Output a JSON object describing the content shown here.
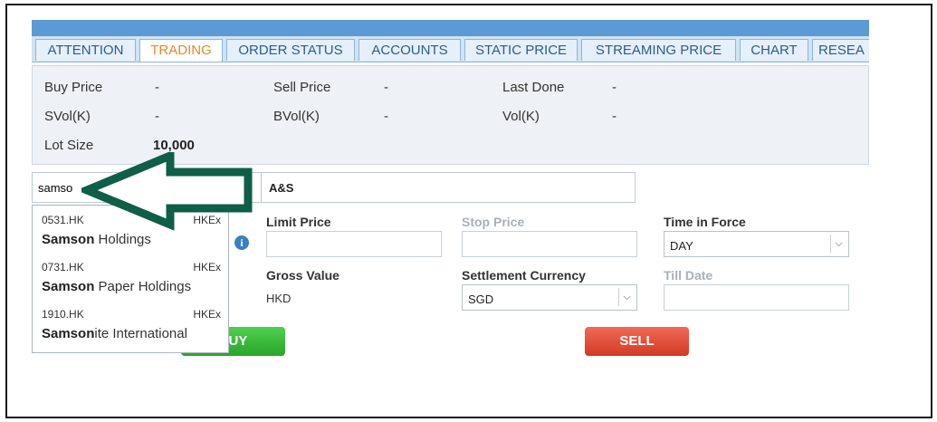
{
  "tabs": [
    {
      "label": "ATTENTION",
      "active": false
    },
    {
      "label": "TRADING",
      "active": true
    },
    {
      "label": "ORDER STATUS",
      "active": false
    },
    {
      "label": "ACCOUNTS",
      "active": false
    },
    {
      "label": "STATIC PRICE",
      "active": false
    },
    {
      "label": "STREAMING PRICE",
      "active": false
    },
    {
      "label": "CHART",
      "active": false
    },
    {
      "label": "RESEA",
      "active": false
    }
  ],
  "quote": {
    "buy_price_label": "Buy Price",
    "buy_price_value": "-",
    "sell_price_label": "Sell Price",
    "sell_price_value": "-",
    "last_done_label": "Last Done",
    "last_done_value": "-",
    "svol_label": "SVol(K)",
    "svol_value": "-",
    "bvol_label": "BVol(K)",
    "bvol_value": "-",
    "vol_label": "Vol(K)",
    "vol_value": "-",
    "lot_size_label": "Lot Size",
    "lot_size_value": "10,000"
  },
  "search": {
    "value": "samso"
  },
  "stock_name": "A&S",
  "suggestions": [
    {
      "code": "0531.HK",
      "exchange": "HKEx",
      "match": "Samson",
      "rest": " Holdings"
    },
    {
      "code": "0731.HK",
      "exchange": "HKEx",
      "match": "Samson",
      "rest": " Paper Holdings"
    },
    {
      "code": "1910.HK",
      "exchange": "HKEx",
      "match": "Samson",
      "rest": "ite International"
    }
  ],
  "order": {
    "limit_price_label": "Limit Price",
    "stop_price_label": "Stop Price",
    "time_in_force_label": "Time in Force",
    "time_in_force_value": "DAY",
    "gross_value_label": "Gross Value",
    "gross_value_currency": "HKD",
    "settlement_currency_label": "Settlement Currency",
    "settlement_currency_value": "SGD",
    "till_date_label": "Till Date",
    "buy_label": "BUY",
    "sell_label": "SELL"
  },
  "colors": {
    "tab_active": "#e58a2b",
    "tab_text": "#2b5d8f",
    "buy": "#2aa52a",
    "sell": "#d23a25",
    "arrow": "#0e5e48"
  },
  "icons": [
    "info-icon",
    "chevron-down-icon",
    "left-arrow-annotation"
  ]
}
